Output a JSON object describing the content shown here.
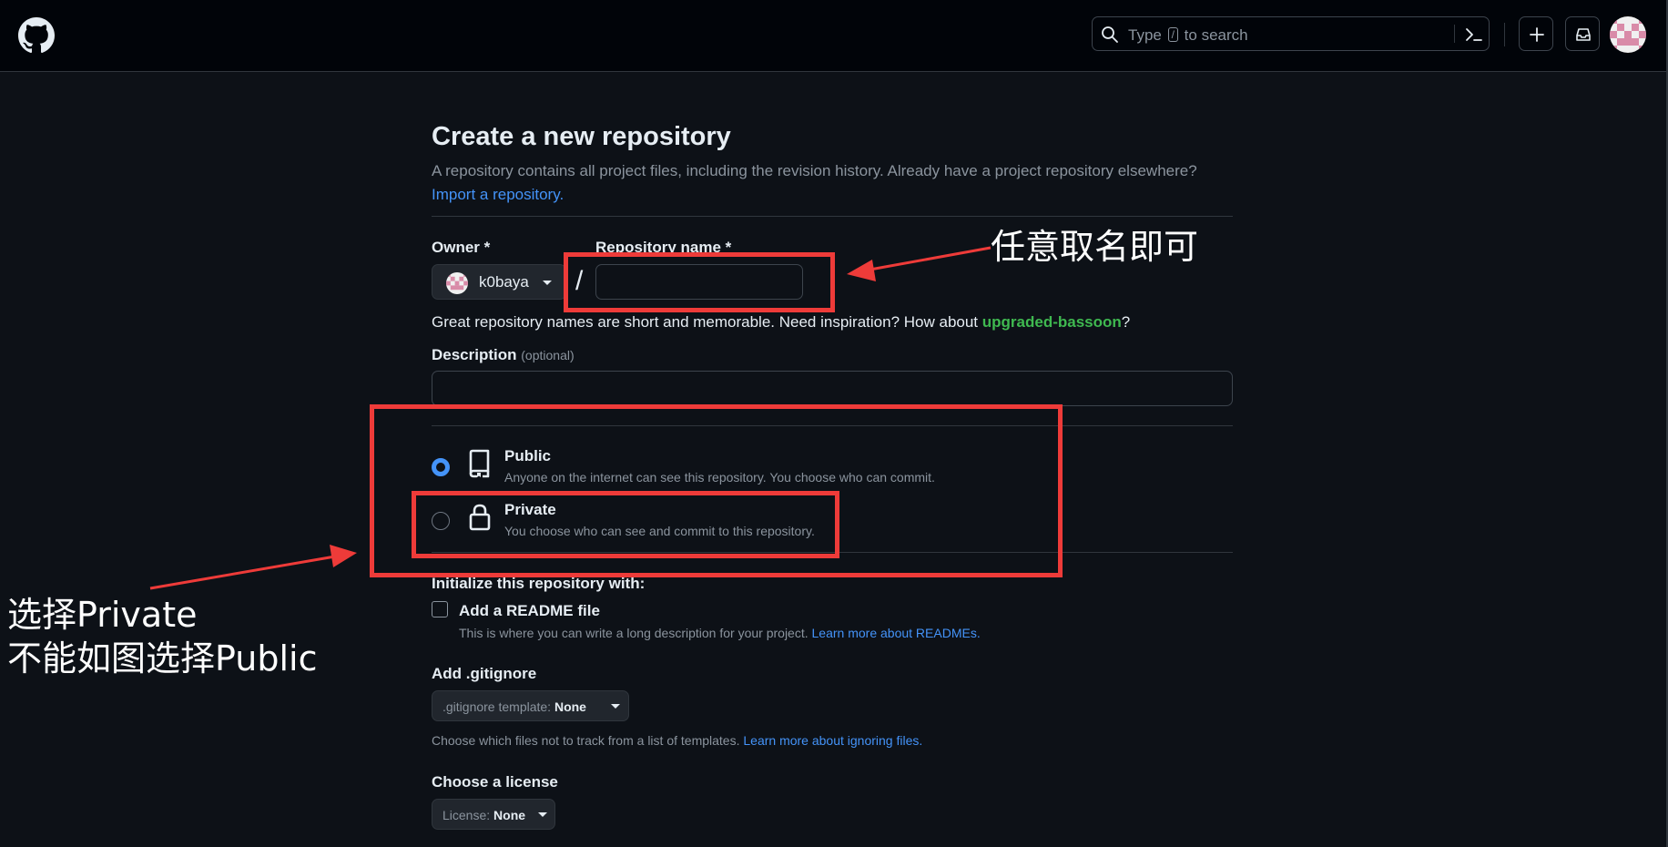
{
  "header": {
    "search_text_before": "Type",
    "search_key": "/",
    "search_text_after": "to search"
  },
  "page": {
    "title": "Create a new repository",
    "subtitle": "A repository contains all project files, including the revision history. Already have a project repository elsewhere?",
    "import_link": "Import a repository."
  },
  "form": {
    "owner_label": "Owner *",
    "owner_value": "k0baya",
    "slash": "/",
    "repo_label": "Repository name *",
    "repo_value": "",
    "hint_text": "Great repository names are short and memorable. Need inspiration? How about ",
    "hint_suggestion": "upgraded-bassoon",
    "hint_end": "?",
    "description_label": "Description",
    "description_optional": "(optional)",
    "description_value": ""
  },
  "visibility": {
    "selected": "public",
    "public_title": "Public",
    "public_desc": "Anyone on the internet can see this repository. You choose who can commit.",
    "private_title": "Private",
    "private_desc": "You choose who can see and commit to this repository."
  },
  "init": {
    "heading": "Initialize this repository with:",
    "readme_label": "Add a README file",
    "readme_checked": false,
    "readme_desc": "This is where you can write a long description for your project.",
    "readme_link": "Learn more about READMEs.",
    "gitignore_heading": "Add .gitignore",
    "gitignore_prefix": ".gitignore template:",
    "gitignore_value": "None",
    "gitignore_note": "Choose which files not to track from a list of templates.",
    "gitignore_link": "Learn more about ignoring files.",
    "license_heading": "Choose a license",
    "license_prefix": "License:",
    "license_value": "None"
  },
  "annotations": {
    "name_note": "任意取名即可",
    "visibility_note_line1": "选择Private",
    "visibility_note_line2": "不能如图选择Public",
    "color": "#ee3b39"
  },
  "icons": {
    "logo": "github-logo-icon",
    "search": "search-icon",
    "command": "command-palette-icon",
    "create": "plus-icon",
    "inbox": "inbox-icon",
    "public": "repo-icon",
    "private": "lock-icon"
  }
}
